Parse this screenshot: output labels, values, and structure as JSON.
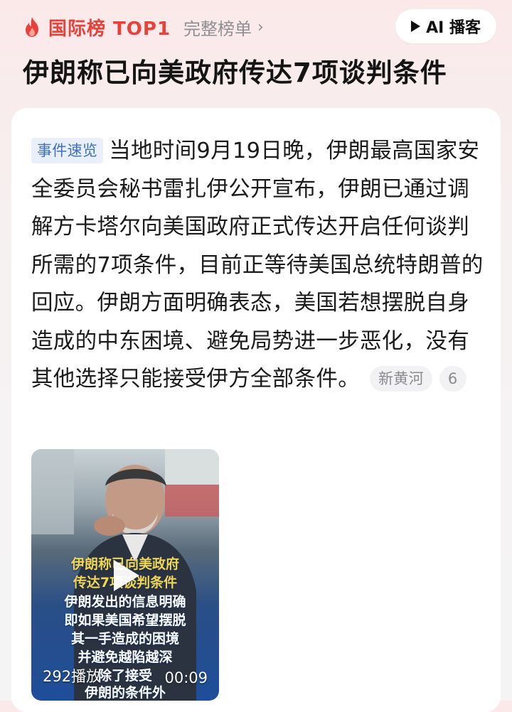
{
  "header": {
    "rank_label": "国际榜 TOP1",
    "full_list_label": "完整榜单",
    "ai_button_label": "AI 播客"
  },
  "headline": "伊朗称已向美政府传达7项谈判条件",
  "article": {
    "tag": "事件速览",
    "text": "当地时间9月19日晚，伊朗最高国家安全委员会秘书雷扎伊公开宣布，伊朗已通过调解方卡塔尔向美国政府正式传达开启任何谈判所需的7项条件，目前正等待美国总统特朗普的回应。伊朗方面明确表态，美国若想摆脱自身造成的中东困境、避免局势进一步恶化，没有其他选择只能接受伊方全部条件。",
    "source": "新黄河",
    "source_count": "6"
  },
  "video": {
    "caption_lines": [
      "伊朗称已向美政府",
      "传达7项谈判条件",
      "伊朗发出的信息明确",
      "即如果美国希望摆脱",
      "其一手造成的困境",
      "并避免越陷越深",
      "除了接受",
      "伊朗的条件外"
    ],
    "plays": "292播放",
    "duration": "00:09"
  },
  "colors": {
    "accent_red": "#e8413a",
    "tag_blue": "#3d6fbf",
    "caption_yellow": "#f5d64b"
  },
  "icons": {
    "flame": "flame-icon",
    "chevron": "chevron-right-icon",
    "play": "play-icon"
  }
}
